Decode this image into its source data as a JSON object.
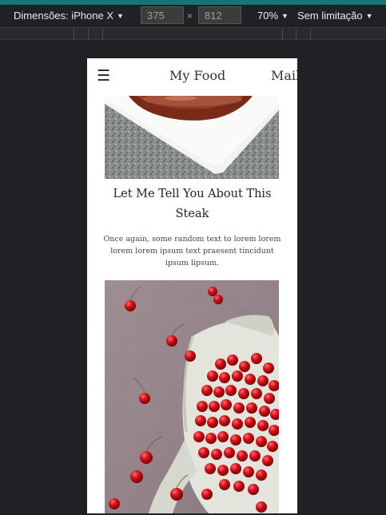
{
  "devtools": {
    "device_label": "Dimensões: iPhone X",
    "width": "375",
    "times": "×",
    "height": "812",
    "zoom": "70%",
    "throttle": "Sem limitação"
  },
  "site": {
    "menu_icon": "☰",
    "brand": "My Food",
    "nav_link": "Mail",
    "post": {
      "title": "Let Me Tell You About This Steak",
      "body": "Once again, some random text to lorem lorem lorem lorem ipsum text praesent tincidunt ipsum lipsum."
    }
  },
  "colors": {
    "accent_strip": "#1f6f76",
    "devtools_bg": "#202124",
    "page_bg": "#ffffff"
  }
}
